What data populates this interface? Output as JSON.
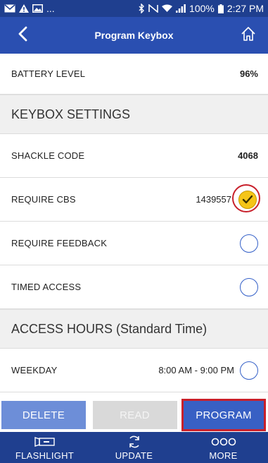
{
  "status_bar": {
    "overflow": "...",
    "battery_percent": "100%",
    "time": "2:27 PM"
  },
  "app_bar": {
    "title": "Program Keybox",
    "back_icon": "chevron-left-icon",
    "home_icon": "home-icon"
  },
  "battery": {
    "label": "BATTERY LEVEL",
    "value": "96%"
  },
  "keybox_settings": {
    "header": "KEYBOX SETTINGS",
    "shackle_code": {
      "label": "SHACKLE CODE",
      "value": "4068"
    },
    "require_cbs": {
      "label": "REQUIRE CBS",
      "value": "1439557",
      "checked": true
    },
    "require_feedback": {
      "label": "REQUIRE FEEDBACK",
      "checked": false
    },
    "timed_access": {
      "label": "TIMED ACCESS",
      "checked": false
    }
  },
  "access_hours": {
    "header": "ACCESS HOURS (Standard Time)",
    "weekday": {
      "label": "WEEKDAY",
      "value": "8:00 AM - 9:00 PM",
      "checked": false
    }
  },
  "actions": {
    "delete_label": "DELETE",
    "read_label": "READ",
    "program_label": "PROGRAM"
  },
  "bottom_nav": {
    "flashlight_label": "FLASHLIGHT",
    "update_label": "UPDATE",
    "more_label": "MORE"
  },
  "colors": {
    "status_bar": "#1f3f8f",
    "app_bar": "#2a4fb1",
    "check_fill": "#f5c518",
    "highlight": "#c8202b"
  }
}
